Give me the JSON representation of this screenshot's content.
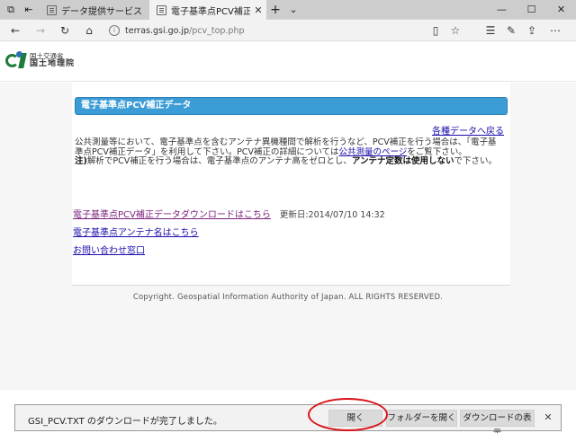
{
  "browser": {
    "tabs": [
      {
        "label": "データ提供サービス",
        "active": false
      },
      {
        "label": "電子基準点PCV補正デー",
        "active": true
      }
    ],
    "new_tab": "+",
    "dropdown": "⌄",
    "window": {
      "minimize": "—",
      "maximize": "☐",
      "close": "✕"
    },
    "address": {
      "domain": "terras.gsi.go.jp",
      "path": "/pcv_top.php"
    }
  },
  "logo": {
    "line1": "国土交通省",
    "line2": "国土地理院"
  },
  "page": {
    "heading": "電子基準点PCV補正データ",
    "back_link": "各種データへ戻る",
    "paragraph": {
      "part1": "公共測量等において、電子基準点を含むアンテナ異機種間で解析を行うなど、PCV補正を行う場合は、「電子基準点PCV補正データ」を利用して下さい。PCV補正の詳細については",
      "link": "公共測量のページ",
      "part2": "をご覧下さい。",
      "note_prefix": "注)",
      "note_body": "解析でPCV補正を行う場合は、電子基準点のアンテナ高をゼロとし、",
      "note_bold": "アンテナ定数は使用しない",
      "note_end": "で下さい。"
    },
    "links": [
      {
        "label": "電子基準点PCV補正データダウンロードはこちら",
        "updated": "更新日:2014/07/10 14:32"
      },
      {
        "label": "電子基準点アンテナ名はこちら"
      },
      {
        "label": "お問い合わせ窓口"
      }
    ],
    "footer": "Copyright. Geospatial Information Authority of Japan. ALL RIGHTS RESERVED."
  },
  "download_bar": {
    "message": "GSI_PCV.TXT のダウンロードが完了しました。",
    "open_label": "開く",
    "open_folder_label": "フォルダーを開く",
    "view_downloads_label": "ダウンロードの表示",
    "close": "✕"
  },
  "colors": {
    "heading_bg": "#3b9cd6",
    "annotation": "#d9141b",
    "visited_link": "#7a1f7a",
    "link": "#1a0dab"
  }
}
